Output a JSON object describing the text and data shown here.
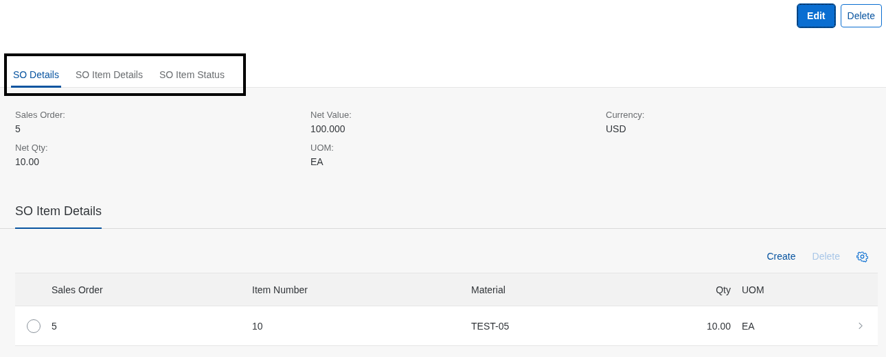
{
  "header_actions": [
    {
      "label": "Edit",
      "kind": "primary"
    },
    {
      "label": "Delete",
      "kind": "ghost"
    }
  ],
  "tabs": [
    {
      "label": "SO Details",
      "selected": true
    },
    {
      "label": "SO Item Details",
      "selected": false
    },
    {
      "label": "SO Item Status",
      "selected": false
    }
  ],
  "fields": [
    {
      "label": "Sales Order:",
      "value": "5"
    },
    {
      "label": "Net Value:",
      "value": "100.000"
    },
    {
      "label": "Currency:",
      "value": "USD"
    },
    {
      "label": "Net Qty:",
      "value": "10.00"
    },
    {
      "label": "UOM:",
      "value": "EA"
    }
  ],
  "section": {
    "title": "SO Item Details"
  },
  "table_toolbar": [
    {
      "label": "Create",
      "disabled": false
    },
    {
      "label": "Delete",
      "disabled": true
    }
  ],
  "table": {
    "columns": [
      {
        "label": "Sales Order",
        "numeric": false
      },
      {
        "label": "Item Number",
        "numeric": false
      },
      {
        "label": "Material",
        "numeric": false
      },
      {
        "label": "Qty",
        "numeric": true
      },
      {
        "label": "UOM",
        "numeric": false
      }
    ],
    "rows": [
      {
        "selected": false,
        "cells": [
          "5",
          "10",
          "TEST-05",
          "10.00",
          "EA"
        ]
      }
    ]
  }
}
